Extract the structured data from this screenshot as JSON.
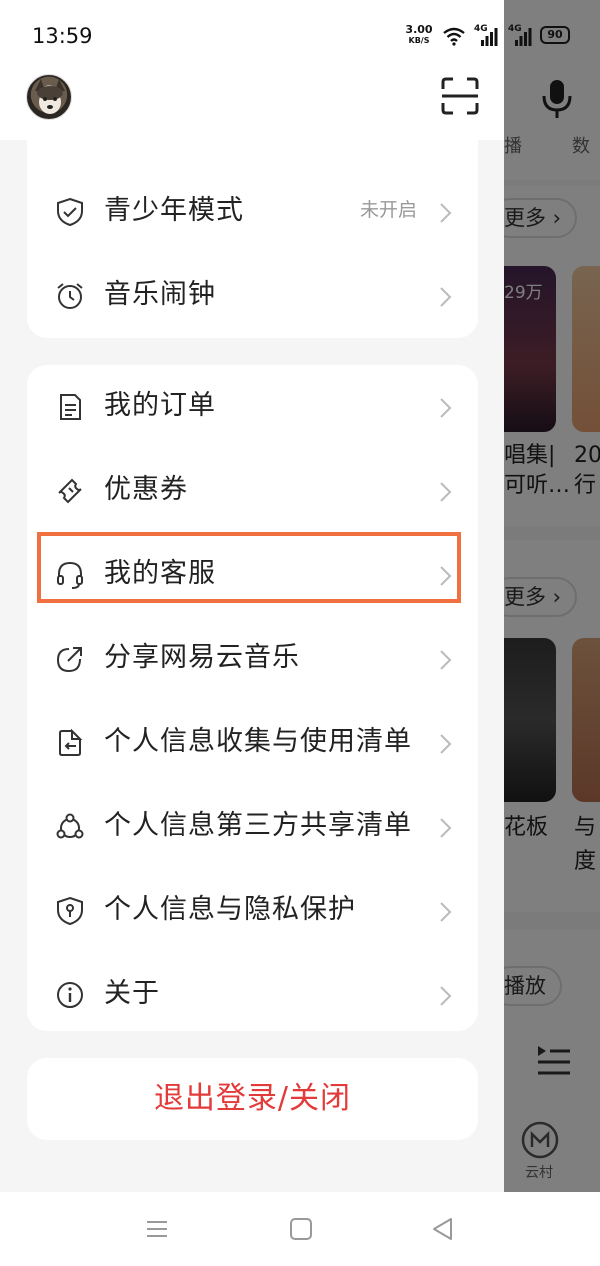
{
  "status_bar": {
    "time": "13:59",
    "net_speed_value": "3.00",
    "net_speed_unit": "KB/S",
    "signal_1": "4G",
    "signal_2": "4G",
    "battery": "90"
  },
  "header": {
    "avatar_icon": "avatar-dog-photo",
    "scan_icon": "scan-icon"
  },
  "drawer": {
    "top_card": {
      "items": [
        {
          "label": "青少年模式",
          "status": "未开启",
          "icon": "shield-check-icon"
        },
        {
          "label": "音乐闹钟",
          "icon": "alarm-clock-icon"
        }
      ]
    },
    "menu_card": {
      "items": [
        {
          "label": "我的订单",
          "icon": "order-document-icon"
        },
        {
          "label": "优惠券",
          "icon": "coupon-ticket-icon"
        },
        {
          "label": "我的客服",
          "icon": "headset-icon"
        },
        {
          "label": "分享网易云音乐",
          "icon": "share-icon"
        },
        {
          "label": "个人信息收集与使用清单",
          "icon": "file-import-icon"
        },
        {
          "label": "个人信息第三方共享清单",
          "icon": "share-nodes-icon"
        },
        {
          "label": "个人信息与隐私保护",
          "icon": "privacy-shield-icon"
        },
        {
          "label": "关于",
          "icon": "info-icon"
        }
      ]
    },
    "logout_label": "退出登录/关闭"
  },
  "background_app": {
    "label_broadcast": "播",
    "label_right_top": "数",
    "more_1": "更多",
    "playcount": "29万",
    "card1_title_line1": "唱集|",
    "card1_title_line2": "可听…",
    "card2_title_line1": "20",
    "card2_title_line2": "行",
    "more_2": "更多",
    "card3_title": "花板",
    "card4_title_line1": "与",
    "card4_title_line2": "度",
    "play_button": "播放",
    "tab_label": "云村"
  },
  "colors": {
    "accent_red": "#e33a3a",
    "highlight_orange": "#f07040"
  }
}
